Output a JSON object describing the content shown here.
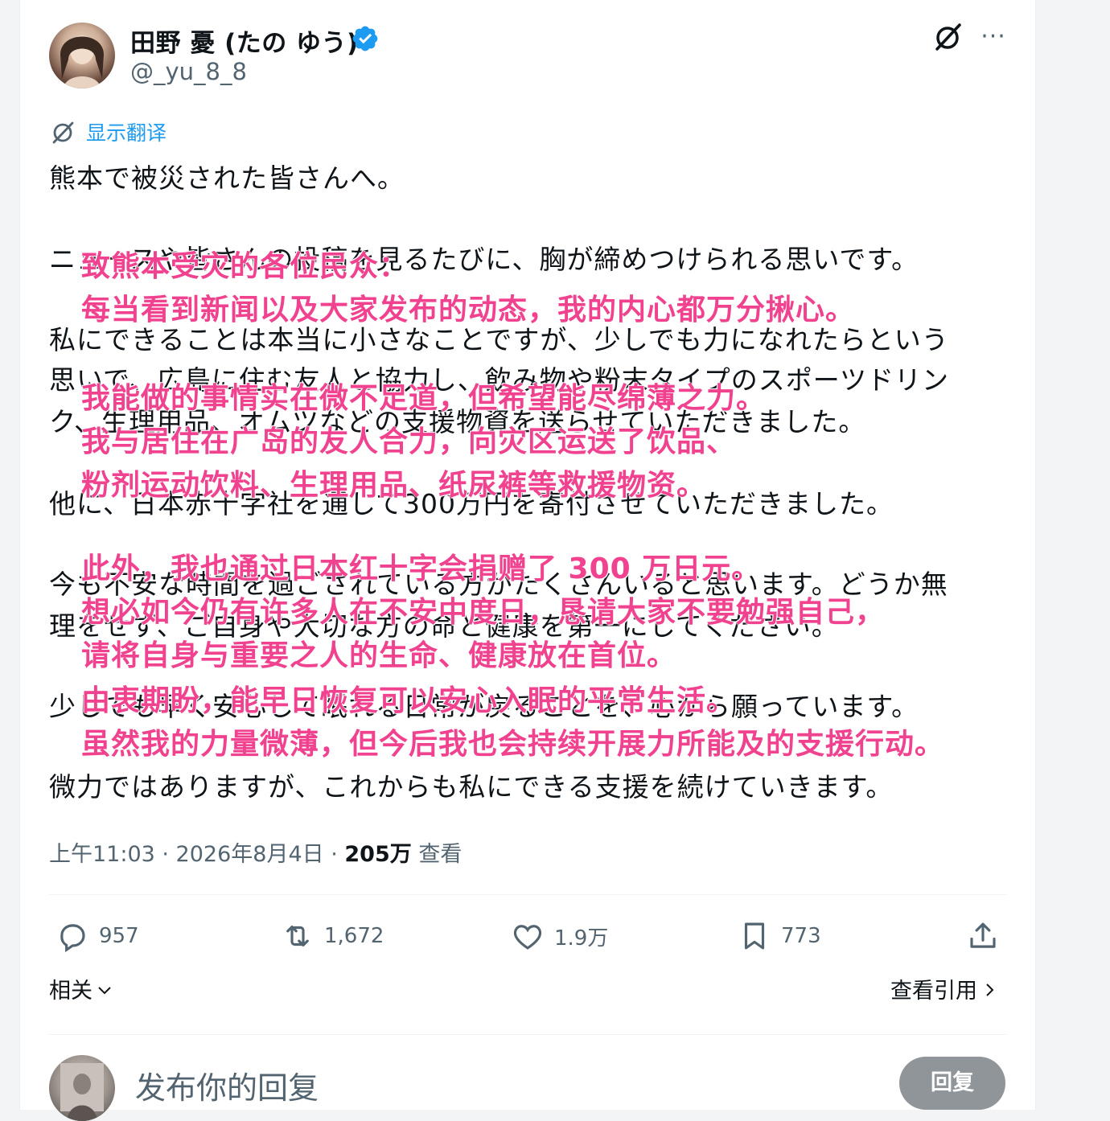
{
  "author": {
    "display_name": "田野 憂 (たの ゆう)",
    "handle": "@_yu_8_8"
  },
  "translate": {
    "label": "显示翻译"
  },
  "tweet_lines": [
    "熊本で被災された皆さんへ。",
    "ニュースや皆さんの投稿を見るたびに、胸が締めつけられる思いです。",
    "私にできることは本当に小さなことですが、少しでも力になれたらという",
    "思いで、広島に住む友人と協力し、飲み物や粉末タイプのスポーツドリン",
    "ク、生理用品、オムツなどの支援物資を送らせていただきました。",
    "他に、日本赤十字社を通して300万円を寄付させていただきました。",
    "今も不安な時間を過ごされている方がたくさんいると思います。どうか無",
    "理をせず、ご自身や大切な方の命と健康を第一にしてください。",
    "少しでも早く安心して眠れる日常が戻ることを、心から願っています。",
    "微力ではありますが、これからも私にできる支援を続けていきます。"
  ],
  "translation_overlay": [
    "致熊本受灾的各位民众：",
    "每当看到新闻以及大家发布的动态，我的内心都万分揪心。",
    "我能做的事情实在微不足道，但希望能尽绵薄之力。",
    "我与居住在广岛的友人合力，向灾区运送了饮品、",
    "粉剂运动饮料、生理用品、纸尿裤等救援物资。",
    "此外，我也通过日本红十字会捐赠了 300 万日元。",
    "想必如今仍有许多人在不安中度日，恳请大家不要勉强自己，",
    "请将自身与重要之人的生命、健康放在首位。",
    "由衷期盼，能早日恢复可以安心入眠的平常生活。",
    "虽然我的力量微薄，但今后我也会持续开展力所能及的支援行动。"
  ],
  "meta": {
    "time_date": "上午11:03 · 2026年8月4日 · ",
    "views_count": "205万",
    "views_label": " 查看"
  },
  "actions": {
    "replies": "957",
    "reposts": "1,672",
    "likes": "1.9万",
    "bookmarks": "773"
  },
  "related_label": "相关",
  "quotes_label": "查看引用",
  "reply_box": {
    "placeholder": "发布你的回复",
    "button_label": "回复"
  },
  "colors": {
    "accent": "#1d9bf0",
    "overlay_pink": "#f0428f",
    "muted": "#536471"
  },
  "icons": [
    "verified-icon",
    "grok-icon",
    "more-icon",
    "translate-icon",
    "reply-icon",
    "repost-icon",
    "like-icon",
    "bookmark-icon",
    "share-icon",
    "chevron-down-icon",
    "chevron-right-icon"
  ]
}
